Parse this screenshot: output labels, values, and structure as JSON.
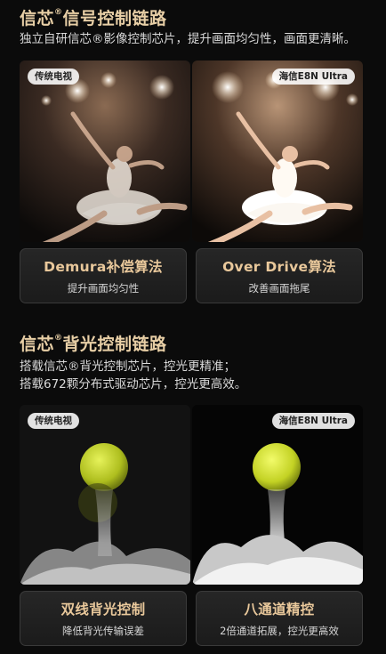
{
  "section1": {
    "title_part1": "信芯",
    "title_reg": "®",
    "title_part2": "信号控制链路",
    "subtitle": "独立自研信芯®影像控制芯片，提升画面均匀性，画面更清晰。",
    "left_label": "传统电视",
    "right_label": "海信E8N Ultra",
    "cards": [
      {
        "title": "Demura补偿算法",
        "desc": "提升画面均匀性"
      },
      {
        "title": "Over Drive算法",
        "desc": "改善画面拖尾"
      }
    ]
  },
  "section2": {
    "title_part1": "信芯",
    "title_reg": "®",
    "title_part2": "背光控制链路",
    "subtitle_line1": "搭载信芯®背光控制芯片，控光更精准；",
    "subtitle_line2": "搭载672颗分布式驱动芯片，控光更高效。",
    "left_label": "传统电视",
    "right_label": "海信E8N Ultra",
    "cards": [
      {
        "title": "双线背光控制",
        "desc": "降低背光传输误差"
      },
      {
        "title": "八通道精控",
        "desc": "2倍通道拓展，控光更高效"
      }
    ]
  },
  "colors": {
    "background": "#0b0b0b",
    "accent_gold": "#e9c89b",
    "card_border": "#3a3a3a"
  }
}
